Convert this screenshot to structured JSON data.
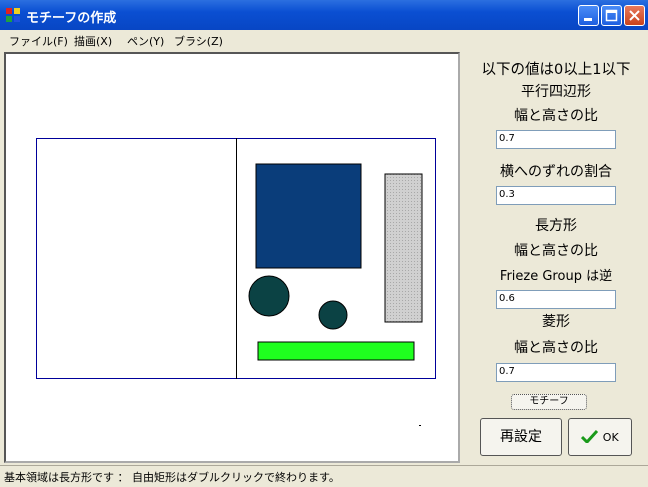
{
  "window": {
    "title": "モチーフの作成"
  },
  "menu": {
    "file": "ファイル(F)",
    "draw": "描画(X)",
    "pen": "ペン(Y)",
    "brush": "ブラシ(Z)"
  },
  "side": {
    "heading": "以下の値は0以上1以下",
    "parallelogram": "平行四辺形",
    "ratio1": "幅と高さの比",
    "value1": "0.7",
    "shift": "横へのずれの割合",
    "value2": "0.3",
    "rectangle": "長方形",
    "ratio2": "幅と高さの比",
    "frieze": "Frieze Group は逆",
    "value3": "0.6",
    "rhombus": "菱形",
    "ratio3": "幅と高さの比",
    "value4": "0.7",
    "motif_button": "モチーフ",
    "reset_button": "再設定",
    "ok_button": "OK"
  },
  "status": "基本領域は長方形です ： 自由矩形はダブルクリックで終わります。",
  "colors": {
    "navy": "#0a3d7a",
    "dark_teal": "#0b4244",
    "green": "#1fff1f",
    "gray": "#c8c8c8",
    "frame": "#00009a"
  }
}
